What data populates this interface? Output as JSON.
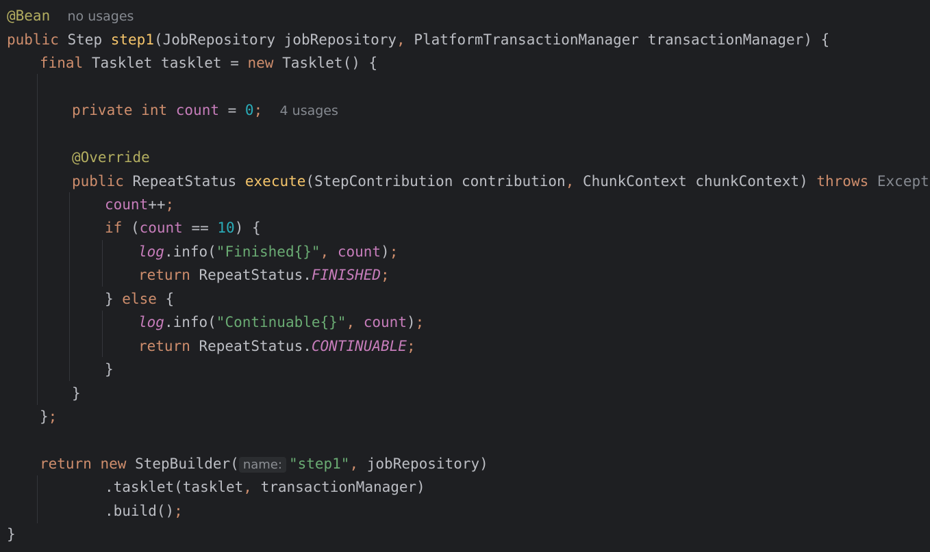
{
  "annotation_bean": "@Bean",
  "usage_hint_bean": "no usages",
  "line_method_sig": {
    "mod": "public",
    "ret": "Step",
    "name": "step1",
    "p1_type": "JobRepository",
    "p1_name": "jobRepository",
    "sep": ",",
    "p2_type": "PlatformTransactionManager",
    "p2_name": "transactionManager",
    "close": ") {"
  },
  "line_tasklet_decl": {
    "kw_final": "final",
    "type": "Tasklet",
    "name": "tasklet = ",
    "kw_new": "new",
    "ctor": "Tasklet() {"
  },
  "line_field": {
    "kw_private": "private",
    "kw_int": "int",
    "name": "count",
    "eq": " = ",
    "value": "0",
    "semi": ";",
    "usage_hint": "4 usages"
  },
  "annotation_override": "@Override",
  "line_execute": {
    "kw_public": "public",
    "ret": "RepeatStatus",
    "name": "execute",
    "p1": "(StepContribution contribution",
    "sep": ",",
    "p2": " ChunkContext chunkContext) ",
    "kw_throws": "throws",
    "exc": "Exception",
    "brace": " {"
  },
  "line_increment": {
    "name": "count",
    "op": "++",
    "semi": ";"
  },
  "line_if": {
    "kw": "if",
    "open": " (",
    "name": "count",
    "op": " == ",
    "value": "10",
    "close": ") {"
  },
  "line_log_finished": {
    "obj": "log",
    "call": ".info(",
    "str": "\"Finished{}\"",
    "sep": ",",
    "arg": " count",
    "close": ")",
    "semi": ";"
  },
  "line_return_finished": {
    "kw": "return",
    "type": " RepeatStatus.",
    "const": "FINISHED",
    "semi": ";"
  },
  "line_else": {
    "open": "} ",
    "kw": "else",
    "brace": " {"
  },
  "line_log_continuable": {
    "obj": "log",
    "call": ".info(",
    "str": "\"Continuable{}\"",
    "sep": ",",
    "arg": " count",
    "close": ")",
    "semi": ";"
  },
  "line_return_continuable": {
    "kw": "return",
    "type": " RepeatStatus.",
    "const": "CONTINUABLE",
    "semi": ";"
  },
  "brace_close_if": "}",
  "brace_close_method": "}",
  "brace_close_class": "}",
  "brace_close_class_semi": ";",
  "line_return_builder": {
    "kw_return": "return",
    "kw_new": "new",
    "type": "StepBuilder(",
    "param_hint": "name:",
    "str": "\"step1\"",
    "sep": ",",
    "arg": " jobRepository)"
  },
  "line_tasklet_call": {
    "text_a": ".tasklet(tasklet",
    "sep": ",",
    "text_b": " transactionManager)"
  },
  "line_build_call": {
    "text": ".build()",
    "semi": ";"
  },
  "brace_close_outer": "}"
}
